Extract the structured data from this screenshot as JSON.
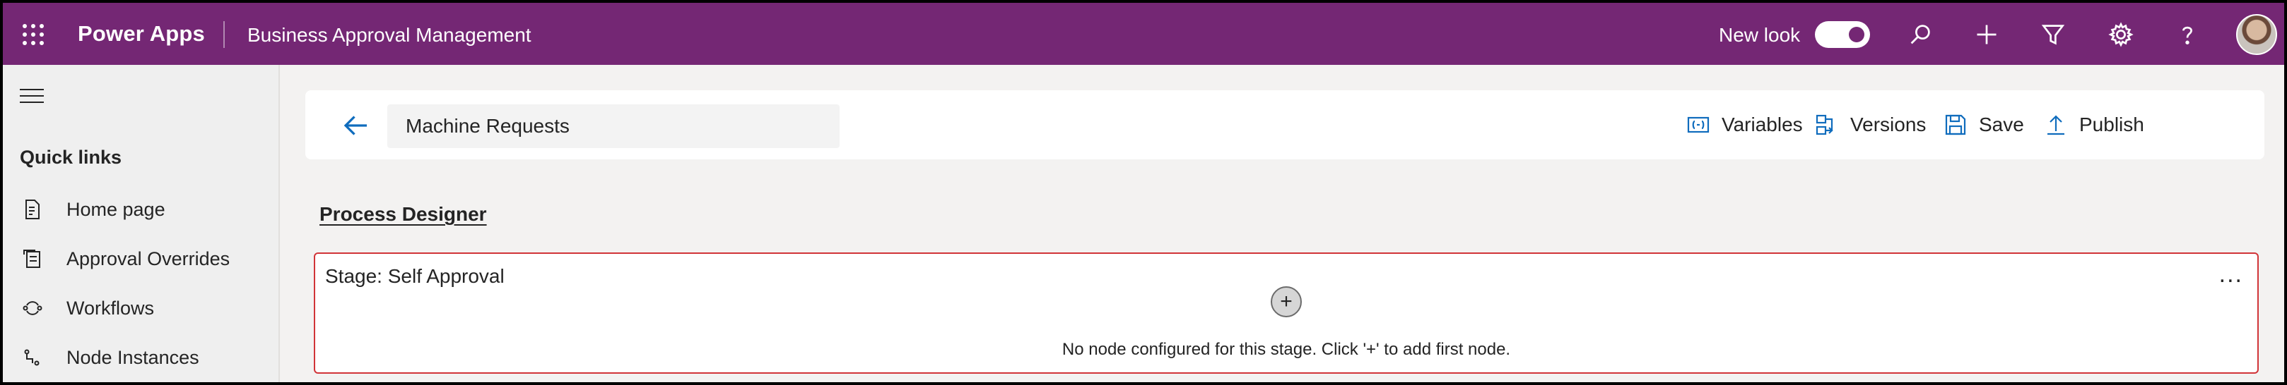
{
  "topbar": {
    "brand": "Power Apps",
    "app_name": "Business Approval Management",
    "new_look_label": "New look",
    "new_look_on": true,
    "icons": [
      "waffle-icon",
      "search-icon",
      "plus-icon",
      "filter-icon",
      "settings-icon",
      "help-icon",
      "avatar"
    ]
  },
  "sidebar": {
    "section_title": "Quick links",
    "items": [
      {
        "label": "Home page",
        "icon": "document-icon"
      },
      {
        "label": "Approval Overrides",
        "icon": "overrides-icon"
      },
      {
        "label": "Workflows",
        "icon": "workflow-icon"
      },
      {
        "label": "Node Instances",
        "icon": "node-instances-icon"
      }
    ]
  },
  "header": {
    "title_value": "Machine Requests",
    "commands": [
      {
        "label": "Variables",
        "icon": "variables-icon"
      },
      {
        "label": "Versions",
        "icon": "versions-icon"
      },
      {
        "label": "Save",
        "icon": "save-icon"
      },
      {
        "label": "Publish",
        "icon": "publish-icon"
      }
    ]
  },
  "designer": {
    "title": "Process Designer",
    "stage": {
      "title": "Stage: Self Approval",
      "more_label": "...",
      "add_label": "+",
      "empty_message": "No node configured for this stage. Click '+' to add first node."
    }
  },
  "colors": {
    "topbar": "#742774",
    "accent": "#0f6cbd",
    "stage_border": "#d13438"
  }
}
